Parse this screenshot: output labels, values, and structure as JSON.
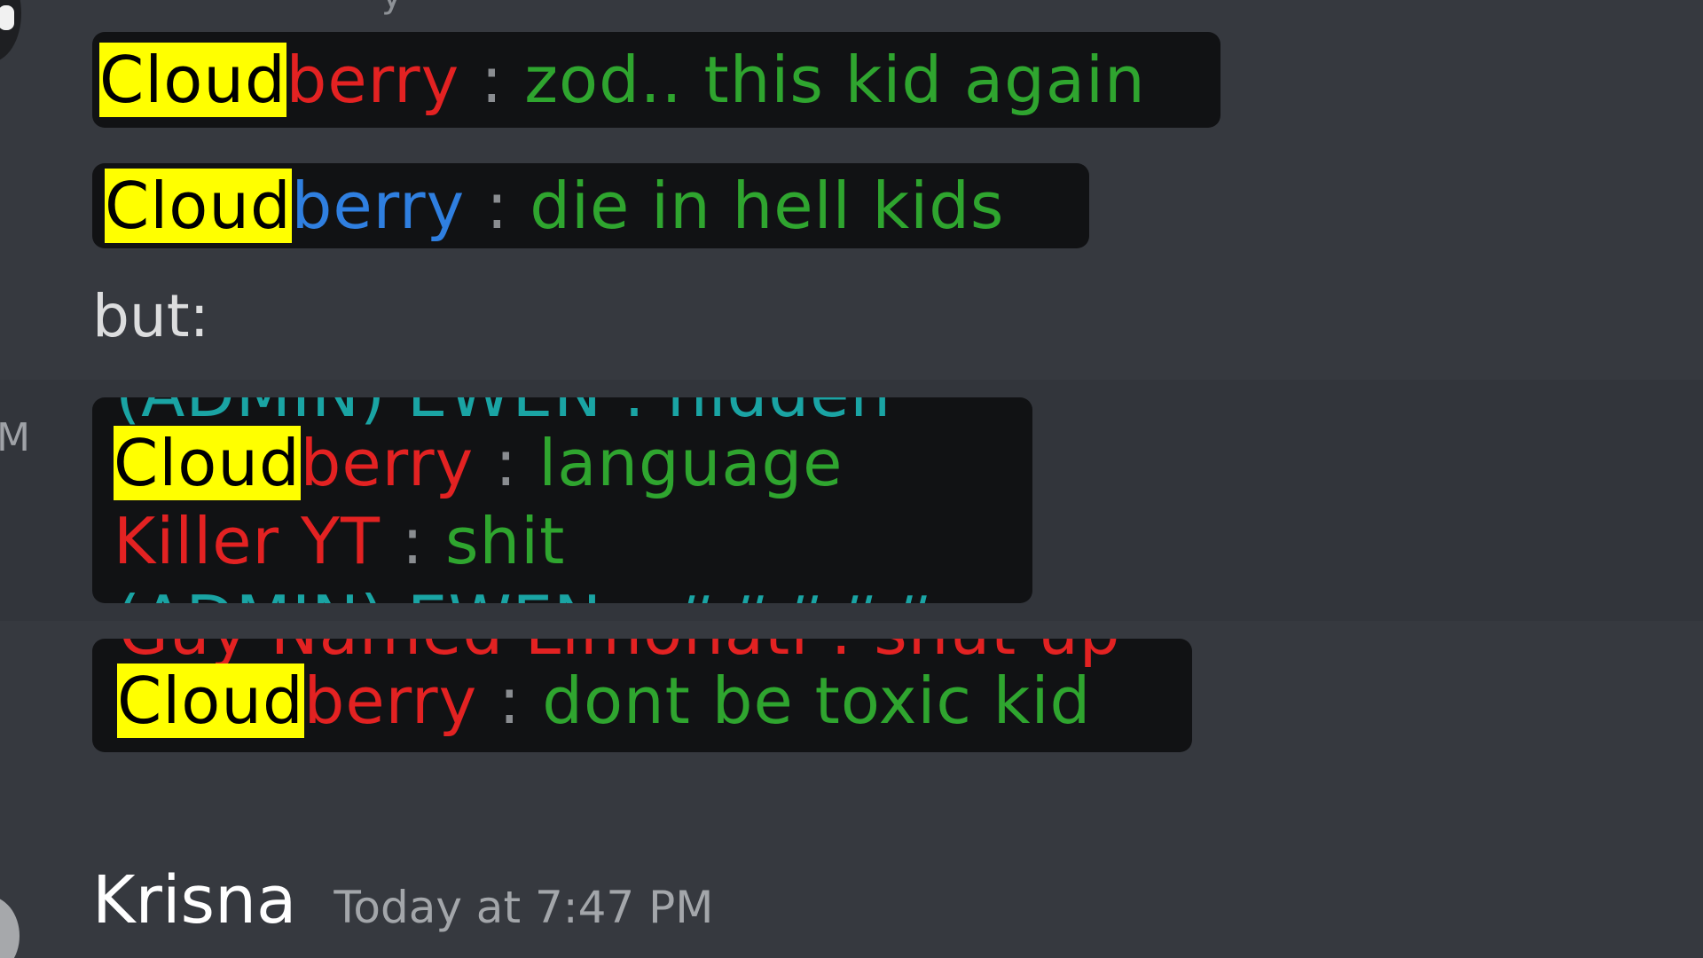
{
  "partial_top_text": "y",
  "partial_timestamp": "M",
  "screenshots": [
    {
      "lines": [
        {
          "hl": "Cloud",
          "name_rest": "berry",
          "sep": " : ",
          "msg": "zod.. this kid again"
        }
      ]
    },
    {
      "lines": [
        {
          "hl": "Cloud",
          "name_rest": "berry",
          "sep": " : ",
          "msg": "die in hell kids"
        }
      ]
    },
    {
      "clipped_top": "(ADMIN) EWEN : hidden",
      "lines": [
        {
          "hl": "Cloud",
          "name_rest": "berry",
          "sep": " : ",
          "msg": "language"
        },
        {
          "name": "Killer YT",
          "sep": " : ",
          "msg": "shit"
        }
      ],
      "clipped_bottom": "(ADMIN) EWEN : #####"
    },
    {
      "clipped_top": "Guy Named Limonati : shut up",
      "lines": [
        {
          "hl": "Cloud",
          "name_rest": "berry",
          "sep": " : ",
          "msg": "dont be toxic kid"
        }
      ]
    }
  ],
  "text_message": "but:",
  "next_message": {
    "author": "Krisna",
    "timestamp": "Today at 7:47 PM"
  }
}
